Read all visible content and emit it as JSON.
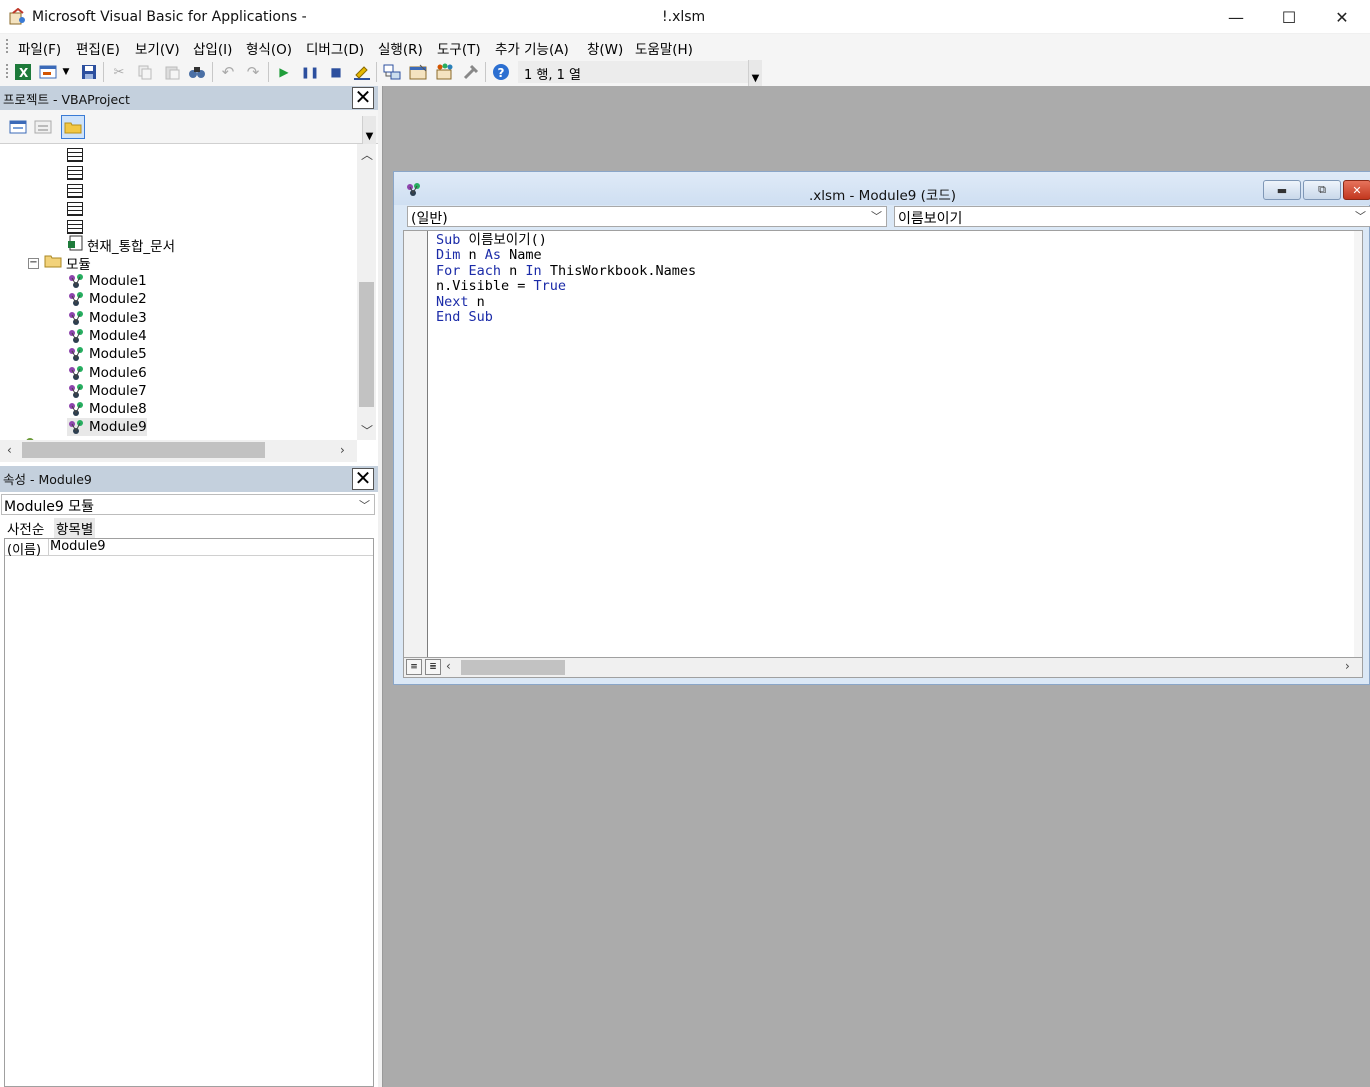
{
  "window": {
    "title": "Microsoft Visual Basic for Applications - ",
    "file_suffix": "!.xlsm",
    "minimize": "—",
    "maximize": "☐",
    "close": "✕"
  },
  "menu": [
    "파일(F)",
    "편집(E)",
    "보기(V)",
    "삽입(I)",
    "형식(O)",
    "디버그(D)",
    "실행(R)",
    "도구(T)",
    "추가 기능(A)",
    "창(W)",
    "도움말(H)"
  ],
  "toolbar": {
    "position_text": "1 행, 1 열",
    "icons": [
      "excel-icon",
      "insert-userform-icon",
      "dropdown-icon",
      "save-icon",
      "cut-icon",
      "copy-icon",
      "paste-icon",
      "find-icon",
      "undo-icon",
      "redo-icon",
      "run-icon",
      "break-icon",
      "reset-icon",
      "design-mode-icon",
      "project-explorer-icon",
      "properties-window-icon",
      "object-browser-icon",
      "toolbox-icon",
      "help-icon"
    ]
  },
  "project_pane": {
    "title": "프로젝트 - VBAProject",
    "close": "✕",
    "tree": {
      "workbook_object": "현재_통합_문서",
      "modules_folder": "모듈",
      "modules": [
        "Module1",
        "Module2",
        "Module3",
        "Module4",
        "Module5",
        "Module6",
        "Module7",
        "Module8",
        "Module9"
      ]
    }
  },
  "properties_pane": {
    "title": "속성 - Module9",
    "close": "✕",
    "selected_object": "Module9 모듈",
    "tabs": [
      "사전순",
      "항목별"
    ],
    "rows": [
      {
        "name": "(이름)",
        "value": "Module9"
      }
    ]
  },
  "code_window": {
    "title": ".xlsm - Module9 (코드)",
    "object_combo": "(일반)",
    "procedure_combo": "이름보이기",
    "code_lines": [
      [
        {
          "t": "Sub",
          "k": true
        },
        {
          "t": " 이름보이기()",
          "k": false
        }
      ],
      [
        {
          "t": "Dim",
          "k": true
        },
        {
          "t": " n ",
          "k": false
        },
        {
          "t": "As",
          "k": true
        },
        {
          "t": " Name",
          "k": false
        }
      ],
      [
        {
          "t": "For Each",
          "k": true
        },
        {
          "t": " n ",
          "k": false
        },
        {
          "t": "In",
          "k": true
        },
        {
          "t": " ThisWorkbook.Names",
          "k": false
        }
      ],
      [
        {
          "t": "n.Visible = ",
          "k": false
        },
        {
          "t": "True",
          "k": true
        }
      ],
      [
        {
          "t": "Next",
          "k": true
        },
        {
          "t": " n",
          "k": false
        }
      ],
      [
        {
          "t": "End Sub",
          "k": true
        }
      ]
    ]
  },
  "colors": {
    "keyword": "#1b2ba8",
    "pane_header": "#c4d0dd",
    "mdi_background": "#ababab"
  }
}
